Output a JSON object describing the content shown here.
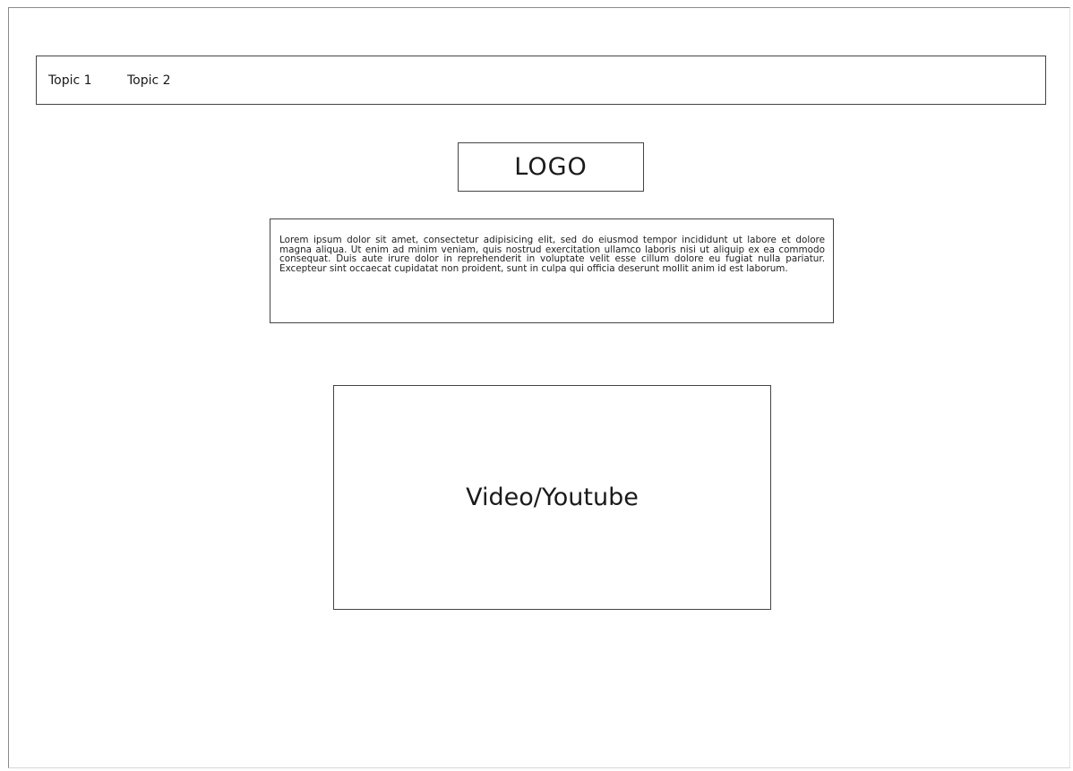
{
  "nav": {
    "items": [
      {
        "label": "Topic 1"
      },
      {
        "label": "Topic 2"
      }
    ]
  },
  "logo": {
    "label": "LOGO"
  },
  "intro": {
    "text": "Lorem ipsum dolor sit amet, consectetur adipisicing elit, sed do eiusmod tempor incididunt ut labore et dolore magna aliqua. Ut enim ad minim veniam, quis nostrud exercitation ullamco laboris nisi ut aliquip ex ea commodo consequat. Duis aute irure dolor in reprehenderit in voluptate velit esse cillum dolore eu fugiat nulla pariatur. Excepteur sint occaecat cupidatat non proident, sunt in culpa qui officia deserunt mollit anim id est laborum."
  },
  "video": {
    "label": "Video/Youtube"
  }
}
